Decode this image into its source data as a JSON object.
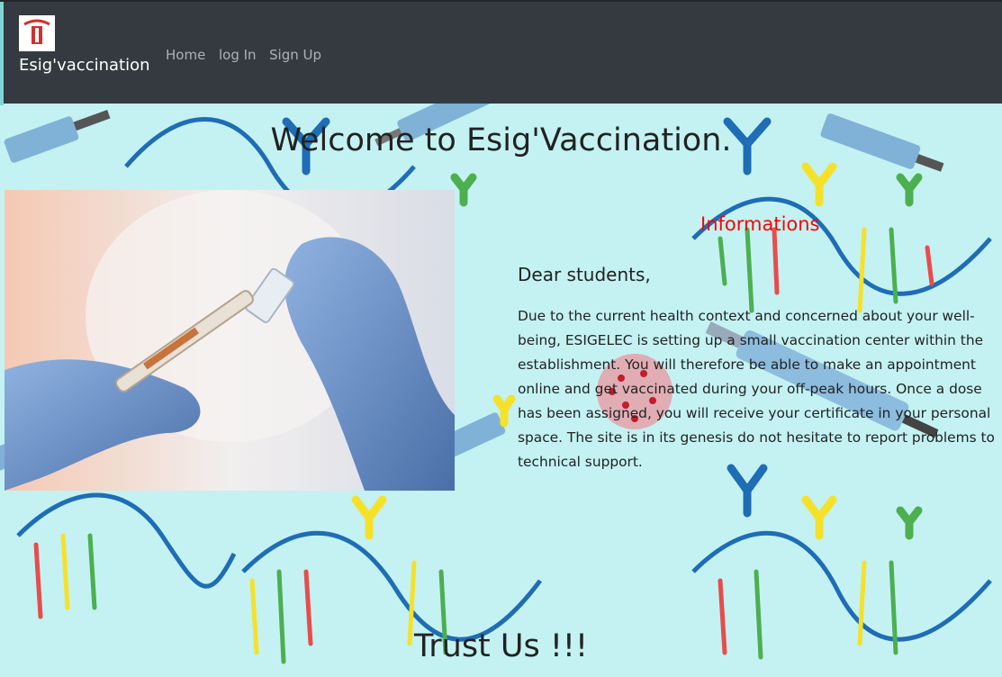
{
  "navbar": {
    "brand": "Esig'vaccination",
    "logo_icon": "esigelec-logo-icon",
    "links": [
      "Home",
      "log In",
      "Sign Up"
    ]
  },
  "main": {
    "welcome_title": "Welcome to Esig'Vaccination.",
    "info_title": "Informations",
    "greeting": "Dear students,",
    "body": "Due to the current health context and concerned about your well-being, ESIGELEC is setting up a small vaccination center within the establishment. You will therefore be able to make an appointment online and get vaccinated during your off-peak hours. Once a dose has been assigned, you will receive your certificate in your personal space. The site is in its genesis do not hesitate to report problems to technical support.",
    "trust_title": "Trust Us !!!"
  },
  "colors": {
    "navbar_bg": "#343a40",
    "page_bg": "#c4f2f2",
    "info_title": "#ff0000"
  }
}
